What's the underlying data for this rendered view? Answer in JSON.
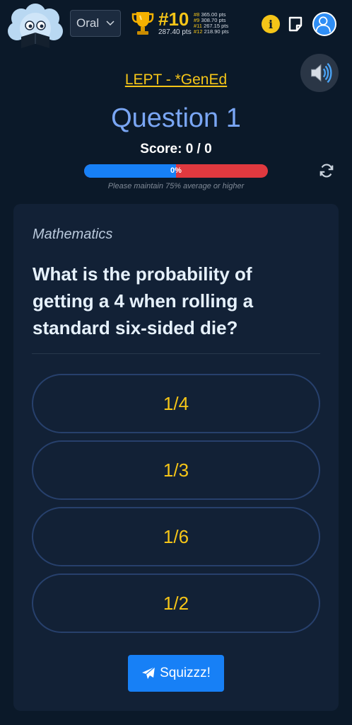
{
  "header": {
    "mode_select": {
      "value": "Oral"
    },
    "rank": {
      "number": "#10",
      "points": "287.40 pts"
    },
    "leaderboard": [
      {
        "rank": "#8",
        "points": "365.00 pts"
      },
      {
        "rank": "#9",
        "points": "308.70 pts"
      },
      {
        "rank": "#11",
        "points": "267.15 pts"
      },
      {
        "rank": "#12",
        "points": "218.90 pts"
      }
    ],
    "info_glyph": "i",
    "icons": {
      "mascot": "mascot-avatar",
      "trophy": "trophy-icon",
      "note": "note-icon",
      "avatar": "user-avatar",
      "sound": "speaker-icon",
      "refresh": "refresh-icon"
    }
  },
  "exam": {
    "subject_link": "LEPT - *GenEd",
    "question_title": "Question 1",
    "score": "Score: 0 / 0",
    "progress_label": "0%",
    "hint": "Please maintain 75% average or higher"
  },
  "card": {
    "category": "Mathematics",
    "question": "What is the probability of getting a 4 when rolling a standard six-sided die?",
    "options": [
      "1/4",
      "1/3",
      "1/6",
      "1/2"
    ],
    "submit_label": "Squizzz!"
  },
  "colors": {
    "background": "#0b1929",
    "card": "#122136",
    "accent_yellow": "#f5c518",
    "title_blue": "#7aa6f4",
    "progress_blue": "#1780f6",
    "progress_red": "#e0393f"
  }
}
